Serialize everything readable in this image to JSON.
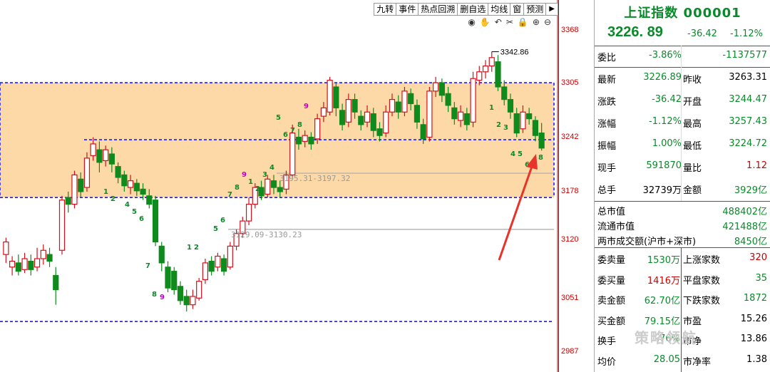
{
  "toolbar": {
    "buttons": [
      "九转",
      "事件",
      "热点回溯",
      "删自选",
      "均线",
      "窗",
      "预测"
    ],
    "arrow": "▶"
  },
  "icons": [
    "eye-icon",
    "hand-icon",
    "undo-icon",
    "scissors-icon",
    "lock-icon",
    "zoom-in-icon",
    "zoom-out-icon"
  ],
  "chart": {
    "y_ticks": [
      "3368",
      "3305",
      "3242",
      "3178",
      "3120",
      "3051",
      "2987"
    ],
    "high_marker": "3342.86",
    "gap_label_1": "3195.31-3197.32",
    "gap_label_2": "3129.09-3130.23"
  },
  "chart_data": {
    "type": "candlestick",
    "y_ticks": [
      3368,
      3305,
      3242,
      3178,
      3120,
      3051,
      2987
    ],
    "annotations": [
      "3342.86",
      "3195.31-3197.32",
      "3129.09-3130.23"
    ],
    "nine_turn_labels": [
      "1",
      "2",
      "4",
      "5",
      "6",
      "7",
      "8",
      "9",
      "1",
      "2",
      "3",
      "4",
      "5",
      "6",
      "7",
      "8",
      "9"
    ]
  },
  "panel": {
    "title": "上证指数 000001",
    "price": "3226. 89",
    "change": "-36.42",
    "change_pct": "-1.12%",
    "rows": [
      {
        "l1": "委比",
        "v1": "-3.86%",
        "c1": "g",
        "l2": "",
        "v2": "-1137577",
        "c2": "g"
      },
      {
        "l1": "最新",
        "v1": "3226.89",
        "c1": "g",
        "l2": "昨收",
        "v2": "3263.31",
        "c2": "b"
      },
      {
        "l1": "涨跌",
        "v1": "-36.42",
        "c1": "g",
        "l2": "开盘",
        "v2": "3244.47",
        "c2": "g"
      },
      {
        "l1": "涨幅",
        "v1": "-1.12%",
        "c1": "g",
        "l2": "最高",
        "v2": "3257.43",
        "c2": "g"
      },
      {
        "l1": "振幅",
        "v1": "1.00%",
        "c1": "g",
        "l2": "最低",
        "v2": "3224.72",
        "c2": "g"
      },
      {
        "l1": "现手",
        "v1": "591870",
        "c1": "g",
        "l2": "量比",
        "v2": "1.12",
        "c2": "r"
      },
      {
        "l1": "总手",
        "v1": "32739万",
        "c1": "b",
        "l2": "金额",
        "v2": "3929亿",
        "c2": "g"
      }
    ],
    "market": [
      {
        "l": "总市值",
        "v": "488402亿"
      },
      {
        "l": "流通市值",
        "v": "421488亿"
      },
      {
        "l": "两市成交额(沪市+深市)",
        "v": "8450亿"
      }
    ],
    "rows2": [
      {
        "l1": "委卖量",
        "v1": "1530万",
        "c1": "g",
        "l2": "上涨家数",
        "v2": "320",
        "c2": "r"
      },
      {
        "l1": "委买量",
        "v1": "1416万",
        "c1": "r",
        "l2": "平盘家数",
        "v2": "35",
        "c2": "g"
      },
      {
        "l1": "卖金额",
        "v1": "62.70亿",
        "c1": "g",
        "l2": "下跌家数",
        "v2": "1872",
        "c2": "g"
      },
      {
        "l1": "买金额",
        "v1": "79.15亿",
        "c1": "g",
        "l2": "市盈",
        "v2": "15.26",
        "c2": "b"
      },
      {
        "l1": "换手",
        "v1": ".76%",
        "c1": "g",
        "l2": "市净",
        "v2": "13.86",
        "c2": "b"
      },
      {
        "l1": "均价",
        "v1": "28.05",
        "c1": "g",
        "l2": "市净率",
        "v2": "1.38",
        "c2": "b"
      }
    ],
    "watermark": "策略领航"
  }
}
